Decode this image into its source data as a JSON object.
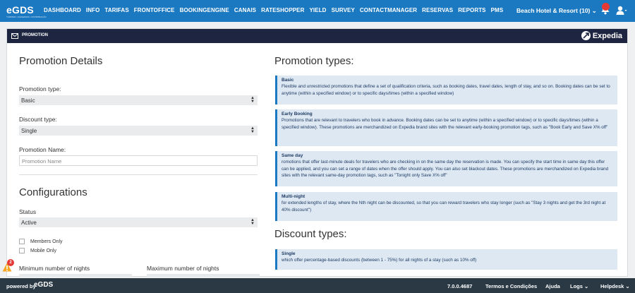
{
  "nav": {
    "logo": "eGDS",
    "logo_sub": "TURISMO • RESERVAS • DISTRIBUIÇÃO",
    "items": [
      "DASHBOARD",
      "INFO",
      "TARIFAS",
      "FRONTOFFICE",
      "BOOKINGENGINE",
      "CANAIS",
      "RATESHOPPER",
      "YIELD",
      "SURVEY",
      "CONTACTMANAGER",
      "RESERVAS",
      "REPORTS",
      "PMS"
    ],
    "hotel": "Beach Hotel & Resort (10) ⌄",
    "colors": {
      "nav_bg": "#1b79c2",
      "panel_head": "#1e2540",
      "footer_bg": "#2b3945",
      "info_box": "#dde8f3",
      "notification": "#e53935"
    }
  },
  "panel": {
    "title": "PROMOTION",
    "brand": "Expedia"
  },
  "details": {
    "heading": "Promotion Details",
    "promotion_type_label": "Promotion type:",
    "promotion_type_value": "Basic",
    "discount_type_label": "Discount type:",
    "discount_type_value": "Single",
    "promotion_name_label": "Promotion Name:",
    "promotion_name_placeholder": "Promotion Name"
  },
  "config": {
    "heading": "Configurations",
    "status_label": "Status",
    "status_value": "Active",
    "members_only": "Members Only",
    "mobile_only": "Mobile Only",
    "min_nights_label": "Minimum number of nights",
    "max_nights_label": "Maximum number of nights"
  },
  "promotion_types": {
    "heading": "Promotion types:",
    "items": [
      {
        "title": "Basic",
        "text": "Flexible and unrestricted promotions that define a set of qualification criteria, such as booking dates, travel dates, length of stay, and so on. Booking dates can be set to anytime (within a specified window) or to specific days/times (within a specified window)"
      },
      {
        "title": "Early Booking",
        "text": "Promotions that are relevant to travelers who book in advance. Booking dates can be set to anytime (within a specified window) or to specific days/times (within a specified window). These promotions are merchandized on Expedia brand sites with the relevant early-booking promotion tags, such as \"Book Early and Save X% off\""
      },
      {
        "title": "Same day",
        "text": "romotions that offer last-minute deals for travelers who are checking in on the same day the reservation is made. You can specify the start time in same day this offer can be applied, and you can set a range of dates when the offer should apply. You can also set blackout dates. These promotions are merchandized on Expedia brand sites with the relevant same-day promotion tags, such as \"Tonight only Save X% off\""
      },
      {
        "title": "Multi-night",
        "text": "for extended lengths of stay, where the Nth night can be discounted, so that you can reward travelers who stay longer (such as \"Stay 3 nights and get the 3rd night at 40% discount\")"
      }
    ]
  },
  "discount_types": {
    "heading": "Discount types:",
    "items": [
      {
        "title": "Single",
        "text": "which offer percentage-based discounts (between 1 - 75%) for all nights of a stay (such as 10% off)"
      }
    ]
  },
  "footer": {
    "powered_by": "powered by",
    "logo": "eGDS",
    "version": "7.0.0.4687",
    "terms": "Termos e Condições",
    "help": "Ajuda",
    "logs": "Logs ⌄",
    "helpdesk": "Helpdesk ⌄"
  },
  "warnings": {
    "count": "2"
  }
}
